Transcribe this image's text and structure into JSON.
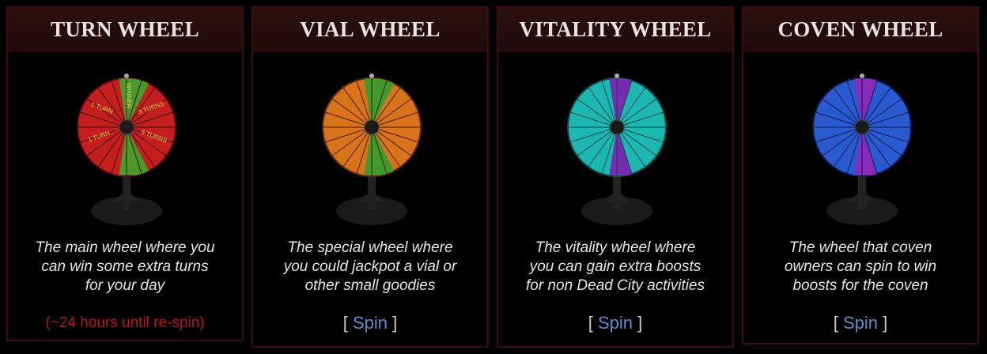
{
  "wheels": [
    {
      "title": "TURN WHEEL",
      "description": [
        "The main wheel where you",
        "can win some extra turns",
        "for your day"
      ],
      "status": "(~24 hours until re-spin)",
      "base_color": "#c41e1e",
      "highlight_color": "#4a9a2a",
      "segment_labels": [
        "WINNER",
        "1 TURN",
        "3 TURNS",
        "5 TURNS"
      ],
      "is_available": false
    },
    {
      "title": "VIAL WHEEL",
      "description": [
        "The special wheel where",
        "you could jackpot a vial or",
        "other small goodies"
      ],
      "action": {
        "open": "[",
        "label": "Spin",
        "close": "]"
      },
      "base_color": "#d9731a",
      "highlight_color": "#3e9a2a",
      "is_available": true
    },
    {
      "title": "VITALITY WHEEL",
      "description": [
        "The vitality wheel where",
        "you can gain extra boosts",
        "for non Dead City activities"
      ],
      "action": {
        "open": "[",
        "label": "Spin",
        "close": "]"
      },
      "base_color": "#1bb7b0",
      "highlight_color": "#7a2ab0",
      "is_available": true
    },
    {
      "title": "COVEN WHEEL",
      "description": [
        "The wheel that coven",
        "owners can spin to win",
        "boosts for the coven"
      ],
      "action": {
        "open": "[",
        "label": "Spin",
        "close": "]"
      },
      "base_color": "#2a5ad0",
      "highlight_color": "#8a2ab8",
      "is_available": true
    }
  ],
  "icons": {
    "wheel": "prize-wheel-icon"
  }
}
